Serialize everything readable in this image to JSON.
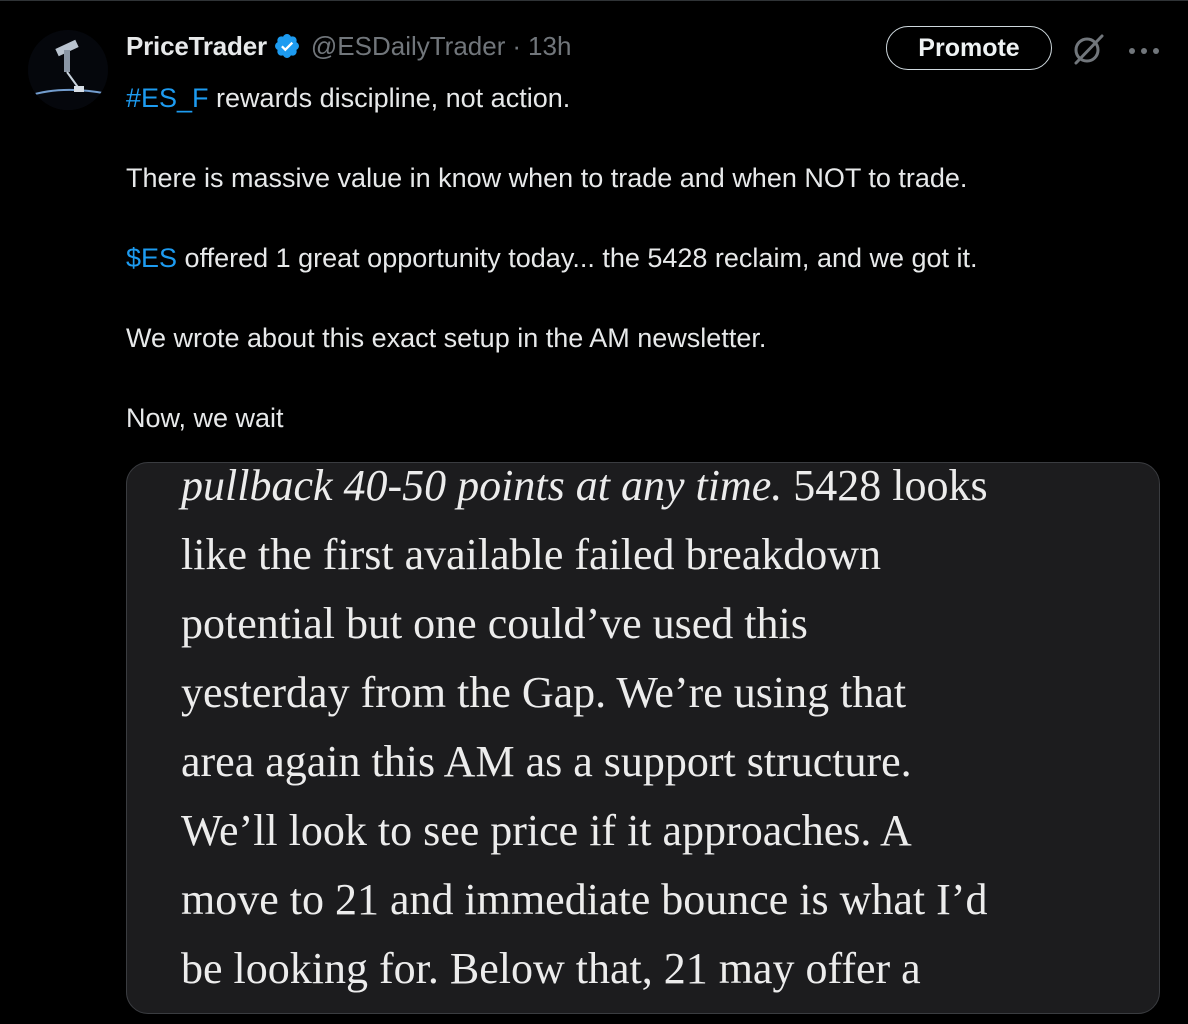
{
  "author": {
    "display_name": "PriceTrader",
    "handle": "@ESDailyTrader",
    "separator": "·",
    "time": "13h",
    "verified_icon": "verified-badge-icon",
    "accent_color": "#1d9bf0"
  },
  "actions": {
    "promote_label": "Promote",
    "grok_icon": "grok-icon",
    "more_icon": "more-options-icon"
  },
  "tweet": {
    "line1_tag": "#ES_F",
    "line1_rest": " rewards discipline, not action.",
    "line2": "There is massive value in know when to trade and when NOT to trade.",
    "line3_tag": "$ES",
    "line3_rest": " offered 1 great opportunity today... the 5428 reclaim, and we got it.",
    "line4": "We wrote about this exact setup in the AM newsletter.",
    "line5": "Now, we wait"
  },
  "media": {
    "line1_italic": "pullback 40-50 points at any time.",
    "line1_rest": " 5428 looks",
    "line2": "like the first available failed breakdown",
    "line3": "potential but one could’ve used this",
    "line4": "yesterday from the Gap. We’re using that",
    "line5": "area again this AM as a support structure.",
    "line6": "We’ll look to see price if it approaches. A",
    "line7": "move to 21 and immediate bounce is what I’d",
    "line8": "be looking for. Below that, 21 may offer a"
  }
}
